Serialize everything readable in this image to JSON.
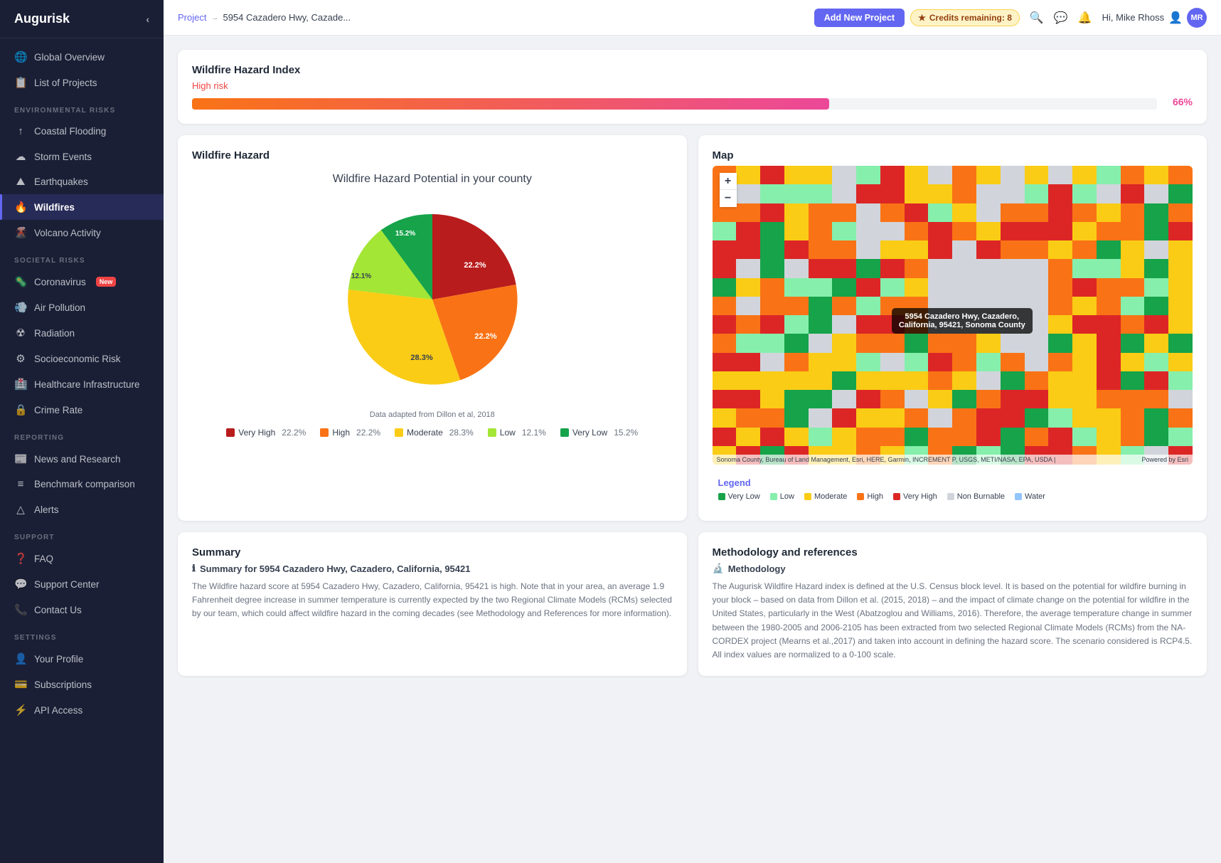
{
  "app": {
    "name": "Augurisk"
  },
  "sidebar": {
    "collapse_icon": "‹",
    "nav_items_top": [
      {
        "label": "Global Overview",
        "icon": "🌐",
        "id": "global-overview",
        "active": false
      },
      {
        "label": "List of Projects",
        "icon": "📋",
        "id": "list-of-projects",
        "active": false
      }
    ],
    "section_environmental": "ENVIRONMENTAL RISKS",
    "env_items": [
      {
        "label": "Coastal Flooding",
        "icon": "↑",
        "id": "coastal-flooding",
        "active": false
      },
      {
        "label": "Storm Events",
        "icon": "☁",
        "id": "storm-events",
        "active": false
      },
      {
        "label": "Earthquakes",
        "icon": "🏔",
        "id": "earthquakes",
        "active": false
      },
      {
        "label": "Wildfires",
        "icon": "🔥",
        "id": "wildfires",
        "active": true
      },
      {
        "label": "Volcano Activity",
        "icon": "🌋",
        "id": "volcano-activity",
        "active": false
      }
    ],
    "section_societal": "SOCIETAL RISKS",
    "soc_items": [
      {
        "label": "Coronavirus",
        "icon": "🦠",
        "id": "coronavirus",
        "active": false,
        "badge": "New"
      },
      {
        "label": "Air Pollution",
        "icon": "💨",
        "id": "air-pollution",
        "active": false
      },
      {
        "label": "Radiation",
        "icon": "☢",
        "id": "radiation",
        "active": false
      },
      {
        "label": "Socioeconomic Risk",
        "icon": "⚙",
        "id": "socioeconomic-risk",
        "active": false
      },
      {
        "label": "Healthcare Infrastructure",
        "icon": "🏥",
        "id": "healthcare-infrastructure",
        "active": false
      },
      {
        "label": "Crime Rate",
        "icon": "🔒",
        "id": "crime-rate",
        "active": false
      }
    ],
    "section_reporting": "REPORTING",
    "rep_items": [
      {
        "label": "News and Research",
        "icon": "📰",
        "id": "news-research",
        "active": false
      },
      {
        "label": "Benchmark comparison",
        "icon": "≡",
        "id": "benchmark-comparison",
        "active": false
      },
      {
        "label": "Alerts",
        "icon": "△",
        "id": "alerts",
        "active": false
      }
    ],
    "section_support": "SUPPORT",
    "sup_items": [
      {
        "label": "FAQ",
        "icon": "❓",
        "id": "faq",
        "active": false
      },
      {
        "label": "Support Center",
        "icon": "💬",
        "id": "support-center",
        "active": false
      },
      {
        "label": "Contact Us",
        "icon": "📞",
        "id": "contact-us",
        "active": false
      }
    ],
    "section_settings": "SETTINGS",
    "set_items": [
      {
        "label": "Your Profile",
        "icon": "👤",
        "id": "your-profile",
        "active": false
      },
      {
        "label": "Subscriptions",
        "icon": "💳",
        "id": "subscriptions",
        "active": false
      },
      {
        "label": "API Access",
        "icon": "⚡",
        "id": "api-access",
        "active": false
      }
    ]
  },
  "topbar": {
    "crumb_project": "Project",
    "crumb_arrow": "→",
    "crumb_location": "5954 Cazadero Hwy, Cazade...",
    "add_project_label": "Add New Project",
    "credits_label": "Credits remaining: 8",
    "credits_icon": "★",
    "user_greeting": "Hi, Mike Rhoss",
    "user_initials": "MR"
  },
  "hazard_index": {
    "title": "Wildfire Hazard Index",
    "risk_level": "High risk",
    "percentage": 66,
    "percentage_label": "66%"
  },
  "wildfire_hazard": {
    "title": "Wildfire Hazard",
    "chart_title": "Wildfire Hazard Potential in your county",
    "source": "Data adapted from Dillon et al, 2018",
    "segments": [
      {
        "label": "Very High",
        "value": 22.2,
        "color": "#b91c1c",
        "display": "22.2%"
      },
      {
        "label": "High",
        "value": 22.2,
        "color": "#f97316",
        "display": "22.2%"
      },
      {
        "label": "Moderate",
        "value": 28.3,
        "color": "#facc15",
        "display": "28.3%"
      },
      {
        "label": "Low",
        "value": 12.1,
        "color": "#a3e635",
        "display": "12.1%"
      },
      {
        "label": "Very Low",
        "value": 15.2,
        "color": "#16a34a",
        "display": "15.2%"
      }
    ]
  },
  "map": {
    "title": "Map",
    "tooltip_text": "5954 Cazadero Hwy, Cazadero,\nCalifornia, 95421, Sonoma County",
    "attribution": "Sonoma County, Bureau of Land Management, Esri, HERE, Garmin, INCREMENT P, USGS, METI/NASA, EPA, USDA |",
    "powered_by": "Powered by Esri",
    "legend_title": "Legend",
    "legend_items": [
      {
        "label": "Very Low",
        "color": "#16a34a"
      },
      {
        "label": "Low",
        "color": "#86efac"
      },
      {
        "label": "Moderate",
        "color": "#facc15"
      },
      {
        "label": "High",
        "color": "#f97316"
      },
      {
        "label": "Very High",
        "color": "#dc2626"
      },
      {
        "label": "Non Burnable",
        "color": "#d1d5db"
      },
      {
        "label": "Water",
        "color": "#93c5fd"
      }
    ]
  },
  "summary": {
    "title": "Summary",
    "subtitle": "Summary for 5954 Cazadero Hwy, Cazadero, California, 95421",
    "text": "The Wildfire hazard score at 5954 Cazadero Hwy, Cazadero, California, 95421 is high. Note that in your area, an average 1.9 Fahrenheit degree increase in summer temperature is currently expected by the two Regional Climate Models (RCMs) selected by our team, which could affect wildfire hazard in the coming decades (see Methodology and References for more information)."
  },
  "methodology": {
    "title": "Methodology and references",
    "subtitle": "Methodology",
    "text": "The Augurisk Wildfire Hazard index is defined at the U.S. Census block level. It is based on the potential for wildfire burning in your block – based on data from Dillon et al. (2015, 2018) – and the impact of climate change on the potential for wildfire in the United States, particularly in the West (Abatzoglou and Williams, 2016). Therefore, the average temperature change in summer between the 1980-2005 and 2006-2105 has been extracted from two selected Regional Climate Models (RCMs) from the NA-CORDEX project (Mearns et al.,2017) and taken into account in defining the hazard score. The scenario considered is RCP4.5. All index values are normalized to a 0-100 scale."
  }
}
